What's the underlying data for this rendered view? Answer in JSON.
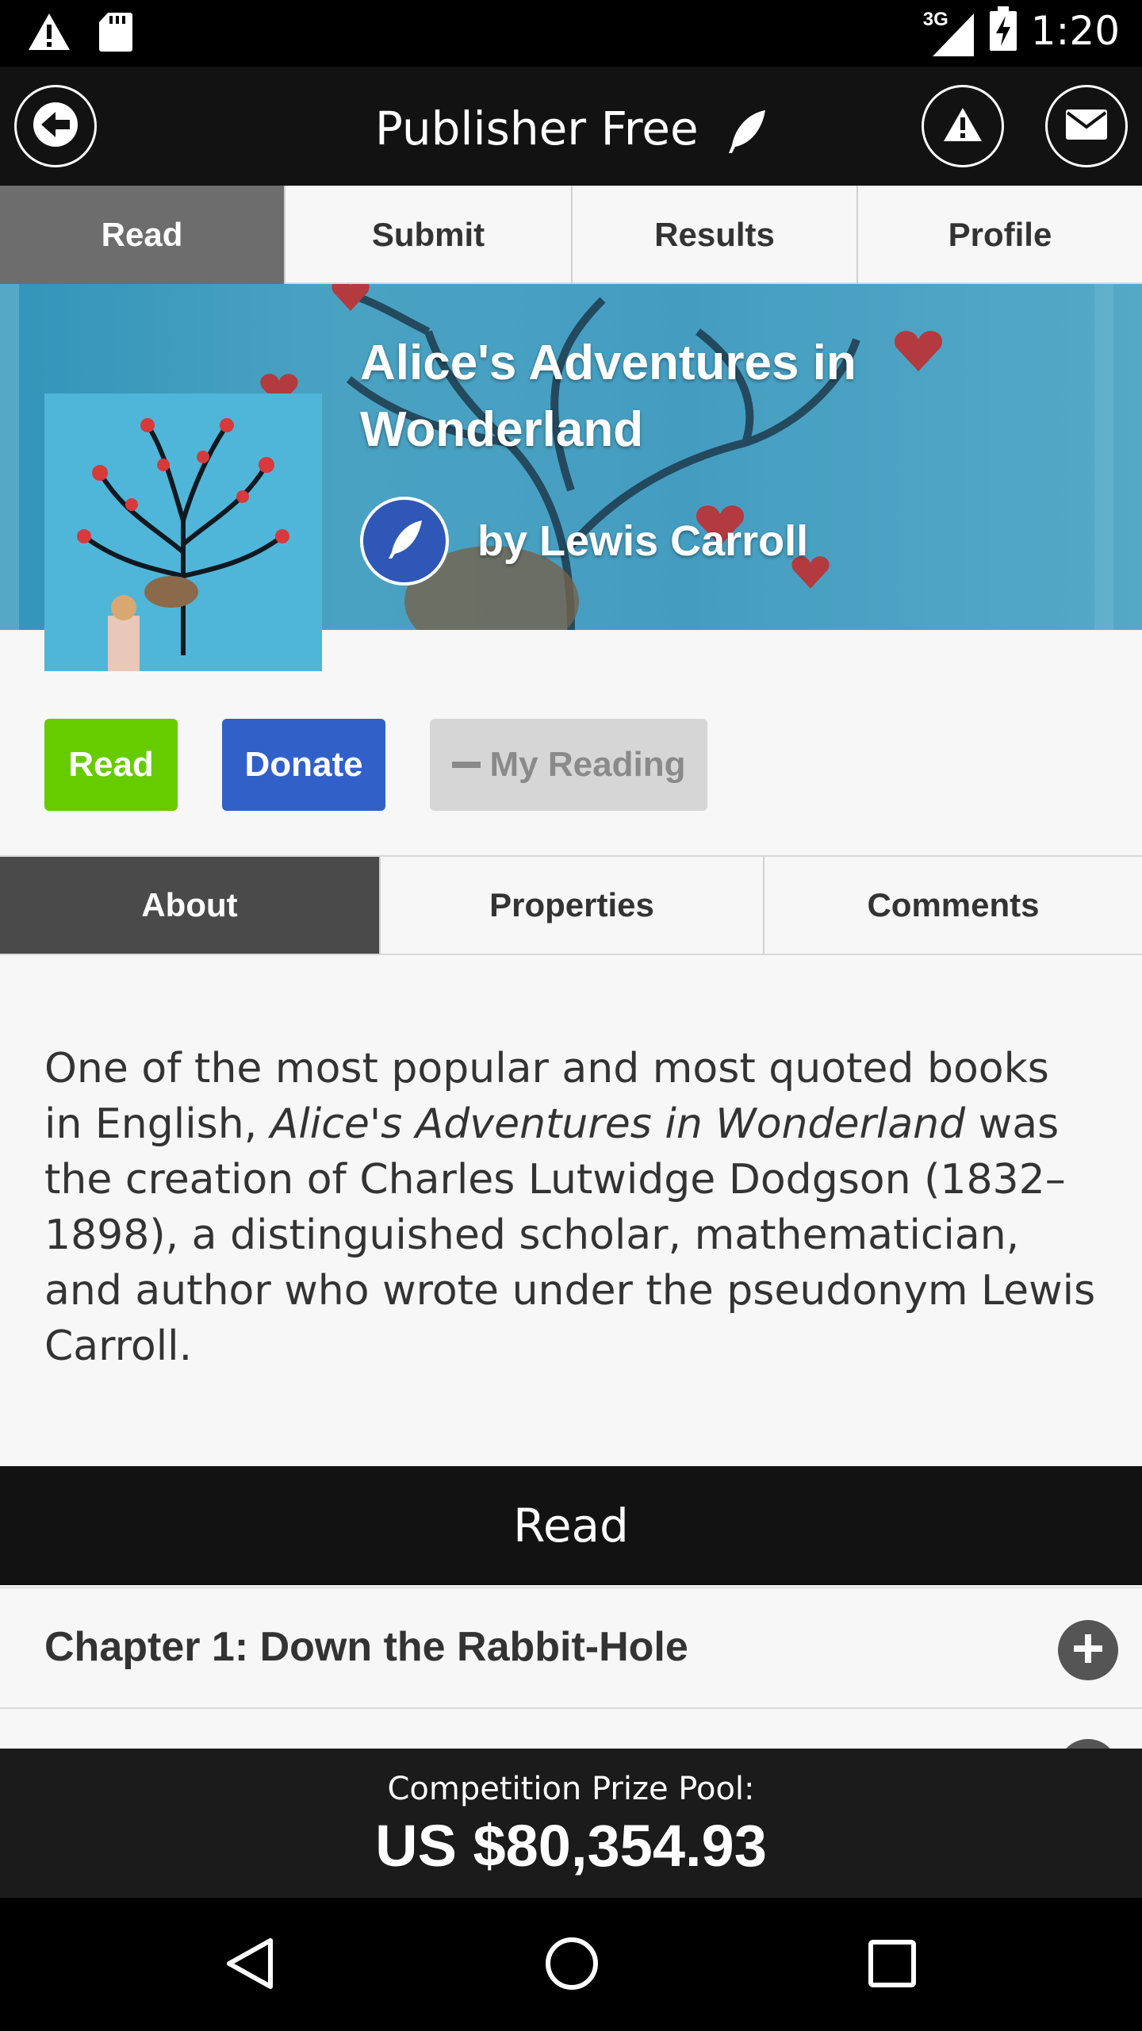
{
  "status_bar": {
    "time": "1:20",
    "network": "3G",
    "icons": [
      "warning-icon",
      "sd-card-icon",
      "signal-icon",
      "battery-icon"
    ]
  },
  "app_bar": {
    "title": "Publisher Free",
    "icons": [
      "back-arrow-icon",
      "quill-icon",
      "alert-icon",
      "mail-icon"
    ]
  },
  "main_tabs": [
    {
      "label": "Read",
      "active": true
    },
    {
      "label": "Submit",
      "active": false
    },
    {
      "label": "Results",
      "active": false
    },
    {
      "label": "Profile",
      "active": false
    }
  ],
  "book": {
    "title": "Alice's Adventures in Wonderland",
    "author": "by Lewis Carroll"
  },
  "actions": {
    "read": "Read",
    "donate": "Donate",
    "my_reading": "My Reading"
  },
  "sub_tabs": [
    {
      "label": "About",
      "active": true
    },
    {
      "label": "Properties",
      "active": false
    },
    {
      "label": "Comments",
      "active": false
    }
  ],
  "about": {
    "part1": "One of the most popular and most quoted books in English, ",
    "italic": "Alice's Adventures in Wonderland",
    "part2": " was the creation of Charles Lutwidge Dodgson (1832–1898), a distinguished scholar, mathematician, and author who wrote under the pseudonym Lewis Carroll."
  },
  "read_section": {
    "header": "Read",
    "chapters": [
      "Chapter 1: Down the Rabbit-Hole"
    ]
  },
  "prize_pool": {
    "label": "Competition Prize Pool:",
    "value": "US $80,354.93"
  },
  "colors": {
    "read_green": "#66cc00",
    "donate_blue": "#3160c9",
    "dark_bar": "#121212",
    "active_tab": "#6d6d6d"
  }
}
